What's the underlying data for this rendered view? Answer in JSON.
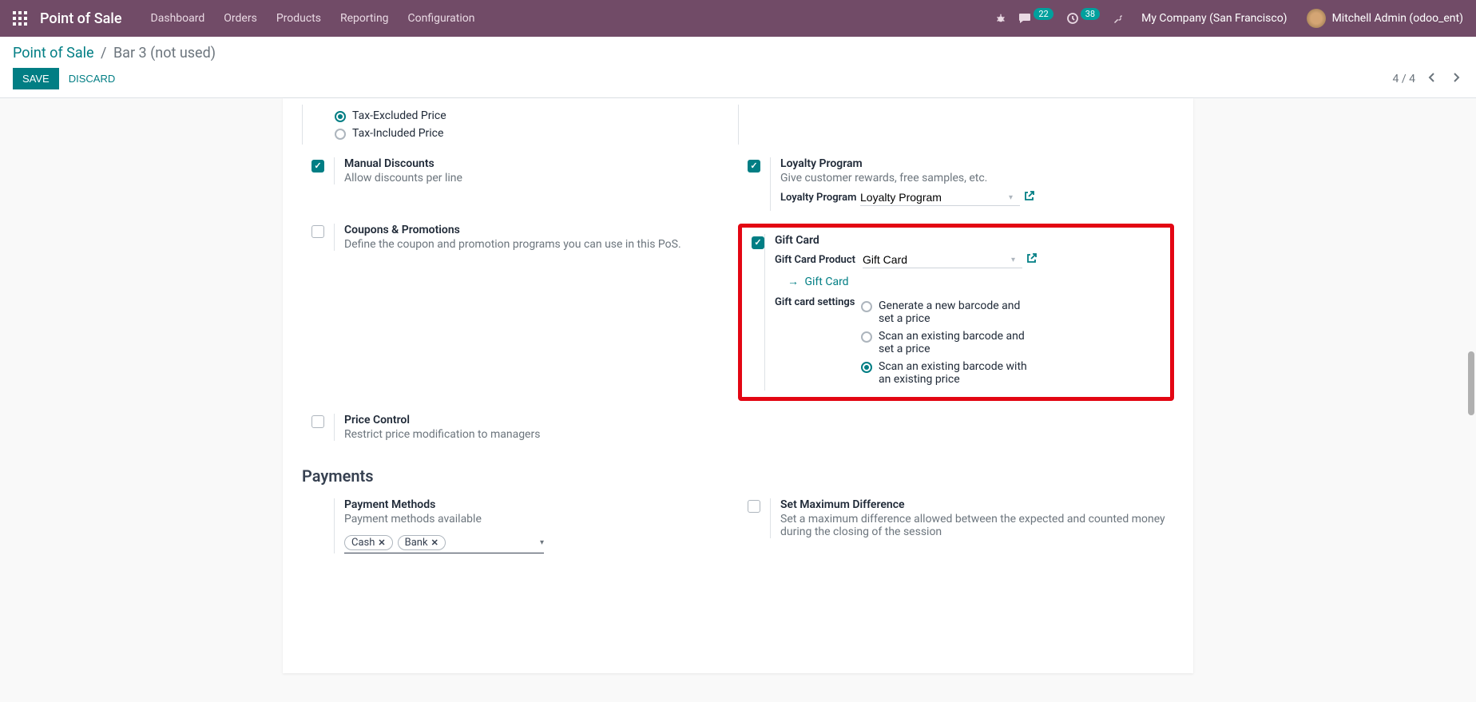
{
  "navbar": {
    "brand": "Point of Sale",
    "menus": [
      "Dashboard",
      "Orders",
      "Products",
      "Reporting",
      "Configuration"
    ],
    "messages_badge": "22",
    "activities_badge": "38",
    "company": "My Company (San Francisco)",
    "user": "Mitchell Admin (odoo_ent)"
  },
  "breadcrumb": {
    "root": "Point of Sale",
    "current": "Bar 3 (not used)"
  },
  "buttons": {
    "save": "Save",
    "discard": "Discard"
  },
  "pager": "4 / 4",
  "pricing": {
    "tax_excluded": "Tax-Excluded Price",
    "tax_included": "Tax-Included Price"
  },
  "manual_discounts": {
    "title": "Manual Discounts",
    "desc": "Allow discounts per line"
  },
  "loyalty": {
    "title": "Loyalty Program",
    "desc": "Give customer rewards, free samples, etc.",
    "field_label": "Loyalty Program",
    "field_value": "Loyalty Program"
  },
  "coupons": {
    "title": "Coupons & Promotions",
    "desc": "Define the coupon and promotion programs you can use in this PoS."
  },
  "giftcard": {
    "title": "Gift Card",
    "product_label": "Gift Card Product",
    "product_value": "Gift Card",
    "link_label": "Gift Card",
    "settings_label": "Gift card settings",
    "opt1": "Generate a new barcode and set a price",
    "opt2": "Scan an existing barcode and set a price",
    "opt3": "Scan an existing barcode with an existing price"
  },
  "price_control": {
    "title": "Price Control",
    "desc": "Restrict price modification to managers"
  },
  "payments": {
    "heading": "Payments",
    "methods_title": "Payment Methods",
    "methods_desc": "Payment methods available",
    "tags": [
      "Cash",
      "Bank"
    ],
    "maxdiff_title": "Set Maximum Difference",
    "maxdiff_desc": "Set a maximum difference allowed between the expected and counted money during the closing of the session"
  }
}
